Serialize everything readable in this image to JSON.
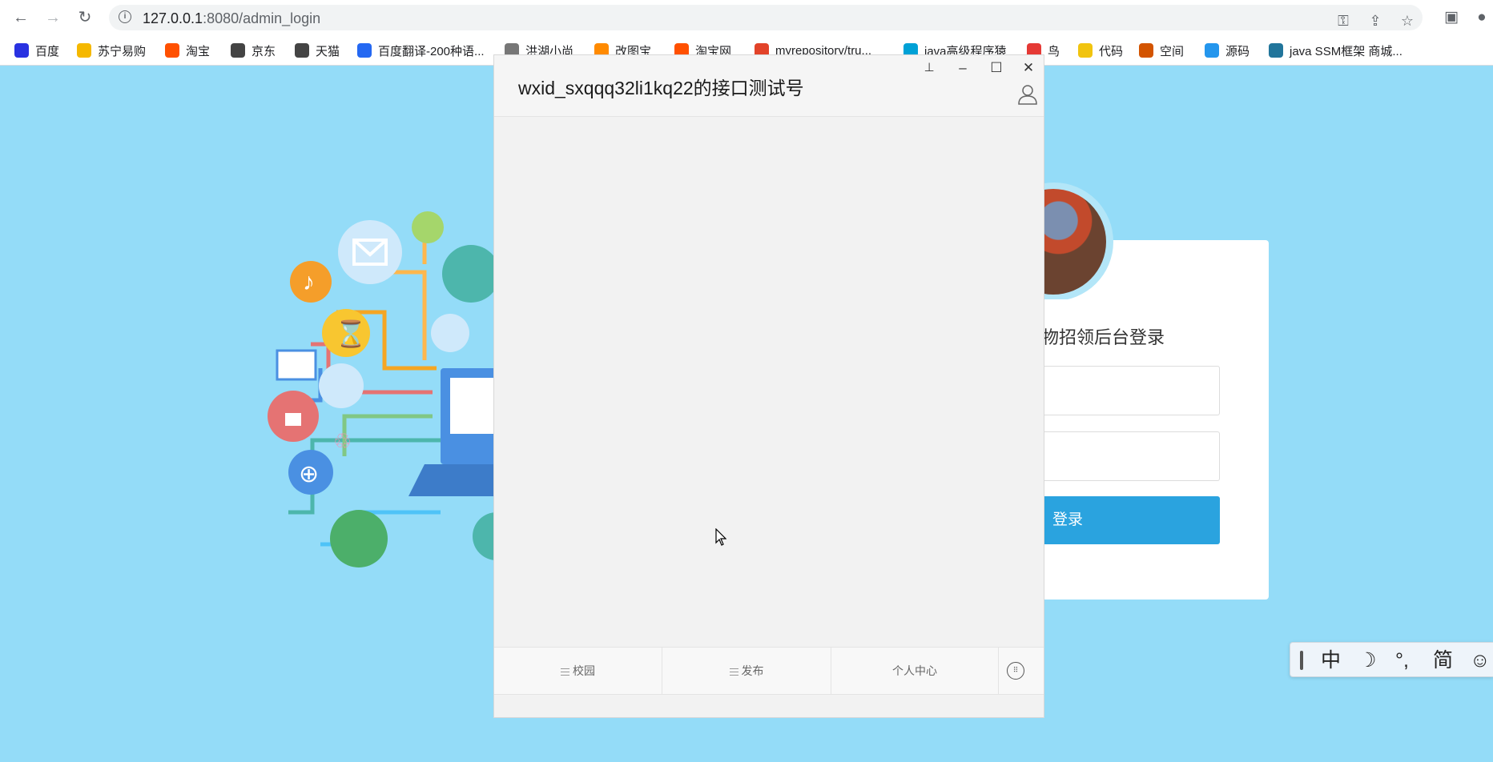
{
  "browser": {
    "url_host": "127.0.0.1",
    "url_rest": ":8080/admin_login",
    "bookmarks": [
      {
        "label": "百度",
        "color": "#2932e1",
        "icon": "baidu-paw-icon"
      },
      {
        "label": "苏宁易购",
        "color": "#f5b800",
        "icon": "suning-icon"
      },
      {
        "label": "淘宝",
        "color": "#ff5000",
        "icon": "taobao-icon"
      },
      {
        "label": "京东",
        "color": "#444444",
        "icon": "globe-icon"
      },
      {
        "label": "天猫",
        "color": "#444444",
        "icon": "globe-icon"
      },
      {
        "label": "百度翻译-200种语...",
        "color": "#2468f2",
        "icon": "translate-icon"
      },
      {
        "label": "洪湖小尚",
        "color": "#777777",
        "icon": "bookmark-icon"
      },
      {
        "label": "改图宝",
        "color": "#ff8a00",
        "icon": "bookmark-icon"
      },
      {
        "label": "淘宝网",
        "color": "#ff5000",
        "icon": "taobao-icon"
      },
      {
        "label": "myrepository/tru...",
        "color": "#e24329",
        "icon": "chrome-icon"
      },
      {
        "label": "java高级程序猿",
        "color": "#00a1d6",
        "icon": "bilibili-icon"
      },
      {
        "label": "鸟",
        "color": "#e53935",
        "icon": "bird-icon"
      },
      {
        "label": "代码",
        "color": "#f1c40f",
        "icon": "bookmark-icon"
      },
      {
        "label": "空间",
        "color": "#d35400",
        "icon": "bookmark-icon"
      },
      {
        "label": "源码",
        "color": "#2496ed",
        "icon": "docker-icon"
      },
      {
        "label": "java SSM框架 商城...",
        "color": "#21759b",
        "icon": "wordpress-icon"
      }
    ]
  },
  "login": {
    "title": "物招领后台登录",
    "button_label": "登录"
  },
  "chat": {
    "title": "wxid_sxqqq32li1kq22的接口测试号",
    "tabs": [
      {
        "label": "校园"
      },
      {
        "label": "发布"
      },
      {
        "label": "个人中心"
      }
    ],
    "keyboard_icon_label": "keyboard-icon"
  },
  "ime": {
    "items": [
      "中",
      "☽",
      "°,",
      "简",
      "☺"
    ]
  }
}
